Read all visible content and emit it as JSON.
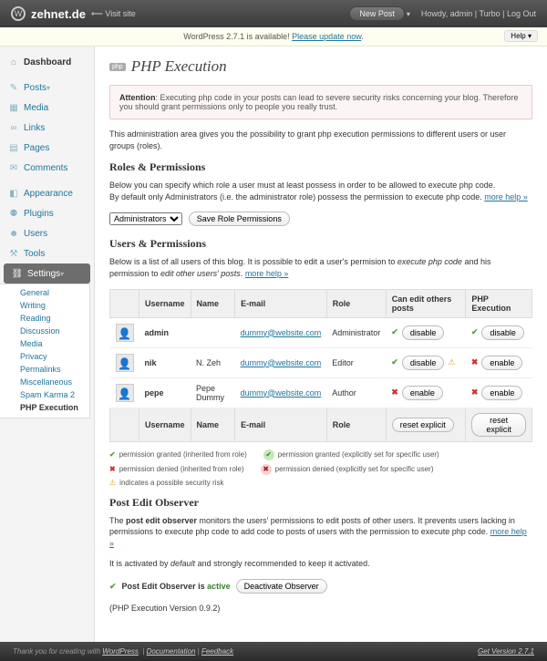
{
  "topbar": {
    "brand": "zehnet.de",
    "visit": "Visit site",
    "new_post": "New Post",
    "howdy_prefix": "Howdy, ",
    "user": "admin",
    "turbo": "Turbo",
    "logout": "Log Out"
  },
  "notice": {
    "text_a": "WordPress 2.7.1 is available! ",
    "link": "Please update now",
    "help": "Help"
  },
  "sidebar": {
    "dashboard": "Dashboard",
    "posts": "Posts",
    "media": "Media",
    "links": "Links",
    "pages": "Pages",
    "comments": "Comments",
    "appearance": "Appearance",
    "plugins": "Plugins",
    "users": "Users",
    "tools": "Tools",
    "settings": "Settings",
    "sub": {
      "general": "General",
      "writing": "Writing",
      "reading": "Reading",
      "discussion": "Discussion",
      "media": "Media",
      "privacy": "Privacy",
      "permalinks": "Permalinks",
      "misc": "Miscellaneous",
      "spam": "Spam Karma 2",
      "phpexec": "PHP Execution"
    }
  },
  "page": {
    "title": "PHP Execution",
    "warning_label": "Attention",
    "warning_text": ": Executing php code in your posts can lead to severe security risks concerning your blog. Therefore you should grant permissions only to people you really trust.",
    "intro": "This administration area gives you the possibility to grant php execution permissions to different users or user groups (roles).",
    "roles_heading": "Roles & Permissions",
    "roles_desc_a": "Below you can specify which role a user must at least possess in order to be allowed to execute php code.",
    "roles_desc_b": "By default only Administrators (i.e. the administrator role) possess the permission to execute php code. ",
    "more_help": "more help »",
    "role_selected": "Administrators",
    "save_roles": "Save Role Permissions",
    "users_heading": "Users & Permissions",
    "users_desc_a": "Below is a list of all users of this blog. It is possible to edit a user's permision to ",
    "users_desc_b": "execute php code",
    "users_desc_c": " and his permission to ",
    "users_desc_d": "edit other users' posts",
    "users_desc_e": ". ",
    "cols": {
      "username": "Username",
      "name": "Name",
      "email": "E-mail",
      "role": "Role",
      "canedit": "Can edit others posts",
      "phpexec": "PHP Execution"
    },
    "users": [
      {
        "username": "admin",
        "name": "",
        "email": "dummy@website.com",
        "role": "Administrator",
        "canedit_icon": "ok-inh",
        "canedit_btn": "disable",
        "warn": false,
        "php_icon": "ok-inh",
        "php_btn": "disable"
      },
      {
        "username": "nik",
        "name": "N. Zeh",
        "email": "dummy@website.com",
        "role": "Editor",
        "canedit_icon": "ok-inh",
        "canedit_btn": "disable",
        "warn": true,
        "php_icon": "no-inh",
        "php_btn": "enable"
      },
      {
        "username": "pepe",
        "name": "Pepe Dummy",
        "email": "dummy@website.com",
        "role": "Author",
        "canedit_icon": "no-inh",
        "canedit_btn": "enable",
        "warn": false,
        "php_icon": "no-inh",
        "php_btn": "enable"
      }
    ],
    "reset": "reset explicit",
    "legend": {
      "ok_inh": "permission granted (inherited from role)",
      "ok_exp": "permission granted (explicitly set for specific user)",
      "no_inh": "permission denied (inherited from role)",
      "no_exp": "permission denied (explicitly set for specific user)",
      "warn": "indicates a possible security risk"
    },
    "observer_heading": "Post Edit Observer",
    "observer_desc_a": "The ",
    "observer_desc_b": "post edit observer",
    "observer_desc_c": " monitors the users' permissions to edit posts of other users. It prevents users lacking in permissions to execute php code to add code to posts of users with the permission to execute php code. ",
    "observer_state_a": "It is activated by ",
    "observer_state_b": "default",
    "observer_state_c": " and strongly recommended to keep it activated.",
    "observer_line_a": "Post Edit Observer is ",
    "observer_line_b": "active",
    "observer_btn": "Deactivate Observer",
    "version": "(PHP Execution Version 0.9.2)"
  },
  "footer": {
    "thanks_a": "Thank you for creating with ",
    "wp": "WordPress",
    "sep": ". | ",
    "doc": "Documentation",
    "sep2": " | ",
    "feedback": "Feedback",
    "get": "Get Version 2.7.1"
  }
}
